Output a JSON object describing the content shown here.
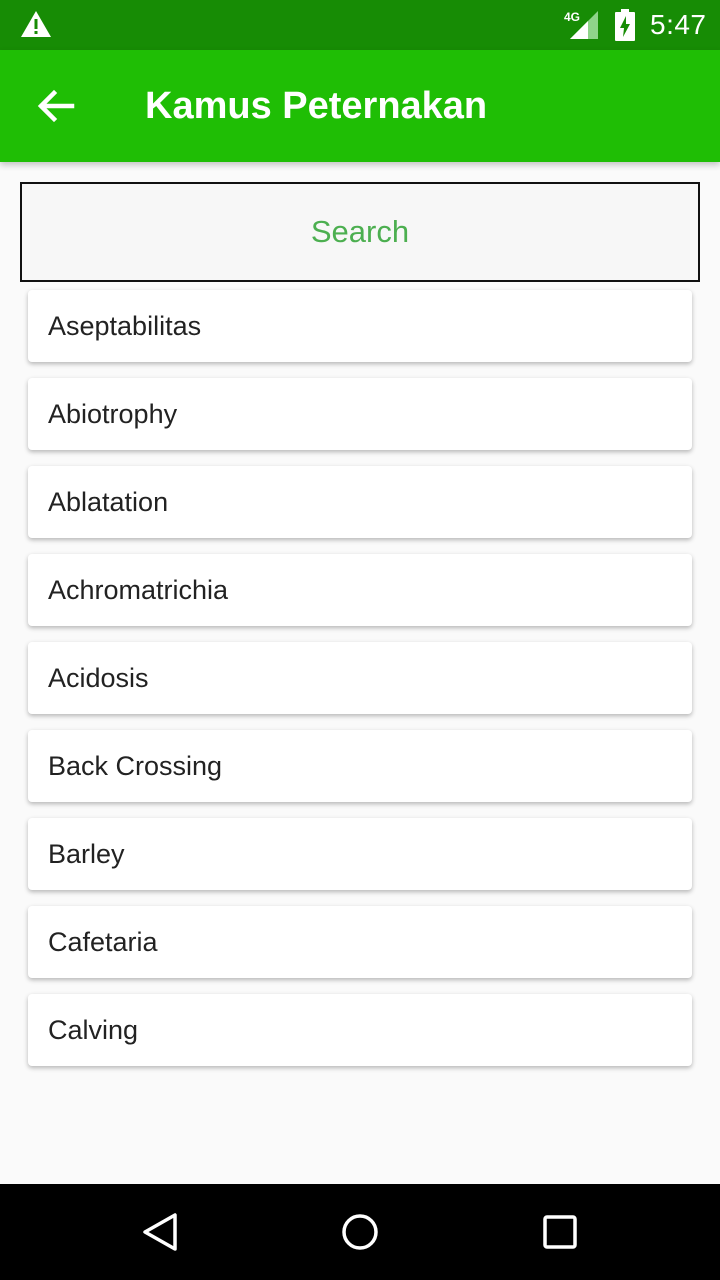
{
  "status_bar": {
    "time": "5:47",
    "network": "4G",
    "icons": [
      "warning-icon",
      "signal-icon",
      "battery-charging-icon"
    ]
  },
  "app_bar": {
    "title": "Kamus Peternakan",
    "back_icon": "arrow-left-icon",
    "color": "#1fbe05"
  },
  "search": {
    "label": "Search",
    "label_color": "#4caf50"
  },
  "list": {
    "items": [
      {
        "label": "Aseptabilitas"
      },
      {
        "label": "Abiotrophy"
      },
      {
        "label": "Ablatation"
      },
      {
        "label": "Achromatrichia"
      },
      {
        "label": "Acidosis"
      },
      {
        "label": "Back Crossing"
      },
      {
        "label": "Barley"
      },
      {
        "label": "Cafetaria"
      },
      {
        "label": "Calving"
      }
    ]
  },
  "nav_bar": {
    "icons": [
      "back-triangle-icon",
      "home-circle-icon",
      "recents-square-icon"
    ]
  },
  "colors": {
    "status_bar": "#178c05",
    "accent": "#1fbe05"
  }
}
